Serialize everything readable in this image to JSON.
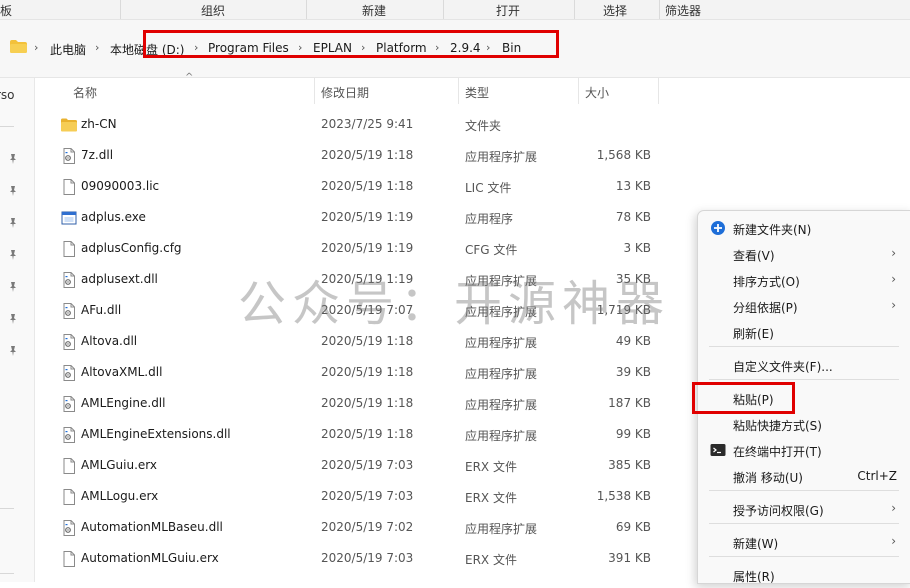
{
  "ribbon": {
    "partial_left": "板",
    "organize": "组织",
    "new": "新建",
    "open": "打开",
    "select": "选择",
    "filter": "筛选器"
  },
  "breadcrumb": [
    "此电脑",
    "本地磁盘 (D:)",
    "Program Files",
    "EPLAN",
    "Platform",
    "2.9.4",
    "Bin"
  ],
  "nav": {
    "partial_label": "rso"
  },
  "columns": {
    "name": "名称",
    "date": "修改日期",
    "type": "类型",
    "size": "大小"
  },
  "files": [
    {
      "name": "zh-CN",
      "date": "2023/7/25 9:41",
      "type": "文件夹",
      "size": "",
      "icon": "folder-icon"
    },
    {
      "name": "7z.dll",
      "date": "2020/5/19 1:18",
      "type": "应用程序扩展",
      "size": "1,568 KB",
      "icon": "dll-icon"
    },
    {
      "name": "09090003.lic",
      "date": "2020/5/19 1:18",
      "type": "LIC 文件",
      "size": "13 KB",
      "icon": "file-icon"
    },
    {
      "name": "adplus.exe",
      "date": "2020/5/19 1:19",
      "type": "应用程序",
      "size": "78 KB",
      "icon": "exe-icon"
    },
    {
      "name": "adplusConfig.cfg",
      "date": "2020/5/19 1:19",
      "type": "CFG 文件",
      "size": "3 KB",
      "icon": "file-icon"
    },
    {
      "name": "adplusext.dll",
      "date": "2020/5/19 1:19",
      "type": "应用程序扩展",
      "size": "35 KB",
      "icon": "dll-icon"
    },
    {
      "name": "AFu.dll",
      "date": "2020/5/19 7:07",
      "type": "应用程序扩展",
      "size": "1,719 KB",
      "icon": "dll-icon"
    },
    {
      "name": "Altova.dll",
      "date": "2020/5/19 1:18",
      "type": "应用程序扩展",
      "size": "49 KB",
      "icon": "dll-icon"
    },
    {
      "name": "AltovaXML.dll",
      "date": "2020/5/19 1:18",
      "type": "应用程序扩展",
      "size": "39 KB",
      "icon": "dll-icon"
    },
    {
      "name": "AMLEngine.dll",
      "date": "2020/5/19 1:18",
      "type": "应用程序扩展",
      "size": "187 KB",
      "icon": "dll-icon"
    },
    {
      "name": "AMLEngineExtensions.dll",
      "date": "2020/5/19 1:18",
      "type": "应用程序扩展",
      "size": "99 KB",
      "icon": "dll-icon"
    },
    {
      "name": "AMLGuiu.erx",
      "date": "2020/5/19 7:03",
      "type": "ERX 文件",
      "size": "385 KB",
      "icon": "file-icon"
    },
    {
      "name": "AMLLogu.erx",
      "date": "2020/5/19 7:03",
      "type": "ERX 文件",
      "size": "1,538 KB",
      "icon": "file-icon"
    },
    {
      "name": "AutomationMLBaseu.dll",
      "date": "2020/5/19 7:02",
      "type": "应用程序扩展",
      "size": "69 KB",
      "icon": "dll-icon"
    },
    {
      "name": "AutomationMLGuiu.erx",
      "date": "2020/5/19 7:03",
      "type": "ERX 文件",
      "size": "391 KB",
      "icon": "file-icon"
    }
  ],
  "watermark": "公众号：开源神器",
  "context_menu": [
    {
      "label": "新建文件夹(N)",
      "icon": "new-folder-icon",
      "arrow": false,
      "shortcut": ""
    },
    {
      "label": "查看(V)",
      "arrow": true,
      "shortcut": ""
    },
    {
      "label": "排序方式(O)",
      "arrow": true,
      "shortcut": ""
    },
    {
      "label": "分组依据(P)",
      "arrow": true,
      "shortcut": ""
    },
    {
      "label": "刷新(E)",
      "arrow": false,
      "shortcut": ""
    },
    {
      "label": "自定义文件夹(F)...",
      "arrow": false,
      "shortcut": ""
    },
    {
      "label": "粘贴(P)",
      "arrow": false,
      "shortcut": ""
    },
    {
      "label": "粘贴快捷方式(S)",
      "arrow": false,
      "shortcut": ""
    },
    {
      "label": "在终端中打开(T)",
      "icon": "terminal-icon",
      "arrow": false,
      "shortcut": ""
    },
    {
      "label": "撤消 移动(U)",
      "arrow": false,
      "shortcut": "Ctrl+Z"
    },
    {
      "label": "授予访问权限(G)",
      "arrow": true,
      "shortcut": ""
    },
    {
      "label": "新建(W)",
      "arrow": true,
      "shortcut": ""
    },
    {
      "label": "属性(R)",
      "arrow": false,
      "shortcut": ""
    }
  ],
  "colors": {
    "highlight_box": "#e00000",
    "folder": "#f3c13a",
    "accent": "#1e6ed8"
  }
}
